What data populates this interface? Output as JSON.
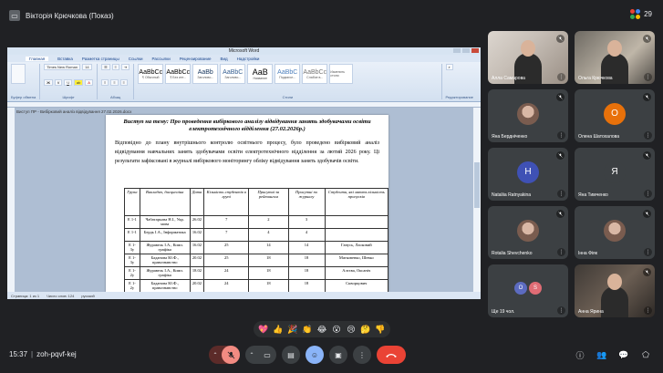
{
  "presenter": {
    "label": "Вікторія Крючкова (Показ)"
  },
  "participant_count": "29",
  "word": {
    "window_title": "Microsoft Word",
    "tabs": [
      "Главная",
      "Вставка",
      "Разметка страницы",
      "Ссылки",
      "Рассылки",
      "Рецензирование",
      "Вид",
      "Надстройки"
    ],
    "groups": [
      "Буфер обмена",
      "Шрифт",
      "Абзац",
      "Стили",
      "Редактирование"
    ],
    "font_name": "Times New Roman",
    "font_size": "14",
    "styles": [
      {
        "sample": "AaBbCc",
        "name": "¶ Обычный"
      },
      {
        "sample": "AaBbCc",
        "name": "¶ Без инт..."
      },
      {
        "sample": "AaBb",
        "name": "Заголово..."
      },
      {
        "sample": "AaBbC",
        "name": "Заголово..."
      },
      {
        "sample": "AaB",
        "name": "Название"
      },
      {
        "sample": "AaBbC",
        "name": "Подзагол..."
      },
      {
        "sample": "AaBbCc",
        "name": "Слабое в..."
      }
    ],
    "change_styles": "Изменить стили",
    "doc_tab": "Виступ ПР - Вибірковий аналіз відвідування 27.02.2026.docx",
    "heading": "Виступ на тему: Про проведення вибіркового аналізу відвідування занять здобувачами освіти електротехнічного відділення (27.02.2026р.)",
    "paragraph": "Відповідно до плану внутрішнього контролю освітнього процесу, було проведено вибірковий аналіз відвідування навчальних занять здобувачами освіти електротехнічного відділення за лютий 2026 року. Ці результати зафіксовані в журналі вибіркового моніторингу обліку відвідування занять здобувачів освіти.",
    "table": {
      "headers": [
        "Група",
        "Викладач, дисципліна",
        "Дата",
        "Кількість студентів в групі",
        "Присутні за рейтингом",
        "Присутні по журналу",
        "Студенти, які мають кількість пропусків"
      ],
      "rows": [
        [
          "Е 1-1",
          "Чабатарьова Н.І., Укр. мова",
          "26.02",
          "7",
          "2",
          "3",
          ""
        ],
        [
          "Е 1-1",
          "Бердь І.А., Інформатика",
          "16.02",
          "7",
          "4",
          "4",
          ""
        ],
        [
          "Е 1-3у",
          "Журавель І.А., Комп. графіка",
          "16.02",
          "25",
          "14",
          "14",
          "Ганусь, Ласковий"
        ],
        [
          "Е 1-3у",
          "Баданова Ю.Ф., правознавство",
          "20.02",
          "25",
          "18",
          "18",
          "Матковенко, Шевко"
        ],
        [
          "Е 1-2у",
          "Журавель І.А., Комп. графіка",
          "18.02",
          "24",
          "18",
          "18",
          "Алєєва, Оксаніч"
        ],
        [
          "Е 1-2у",
          "Баданова Ю.Ф., правознавство",
          "20.02",
          "24",
          "18",
          "18",
          "Скворцович"
        ]
      ]
    },
    "status_page": "Страница: 1 из 1",
    "status_words": "Число слов: 124",
    "status_lang": "русский"
  },
  "participants": [
    {
      "name": "Алла Самарова",
      "kind": "video1",
      "muted": true
    },
    {
      "name": "Ольга Крючкова",
      "kind": "video2",
      "muted": true
    },
    {
      "name": "Яна Бердніченко",
      "kind": "photo",
      "muted": true
    },
    {
      "name": "Олена Шатохалова",
      "kind": "initial",
      "initial": "О",
      "color": "#e8710a",
      "muted": true
    },
    {
      "name": "Nataliia Ratnyakina",
      "kind": "initial",
      "initial": "Н",
      "color": "#3f51b5",
      "muted": true
    },
    {
      "name": "Яна Тимченко",
      "kind": "initial",
      "initial": "Я",
      "color": "#3c4043",
      "muted": true
    },
    {
      "name": "Rotalia Shevchenko",
      "kind": "photo",
      "muted": true
    },
    {
      "name": "Інна Фіяк",
      "kind": "photo",
      "muted": true
    },
    {
      "name": "Ще 19 чол.",
      "kind": "multi",
      "muted": false
    },
    {
      "name": "Анна Ярина",
      "kind": "video3",
      "muted": true
    }
  ],
  "reactions": [
    "💖",
    "👍",
    "🎉",
    "👏",
    "😂",
    "😮",
    "😢",
    "🤔",
    "👎"
  ],
  "meeting": {
    "time": "15:37",
    "separator": "|",
    "code": "zoh-pqvf-kej"
  }
}
